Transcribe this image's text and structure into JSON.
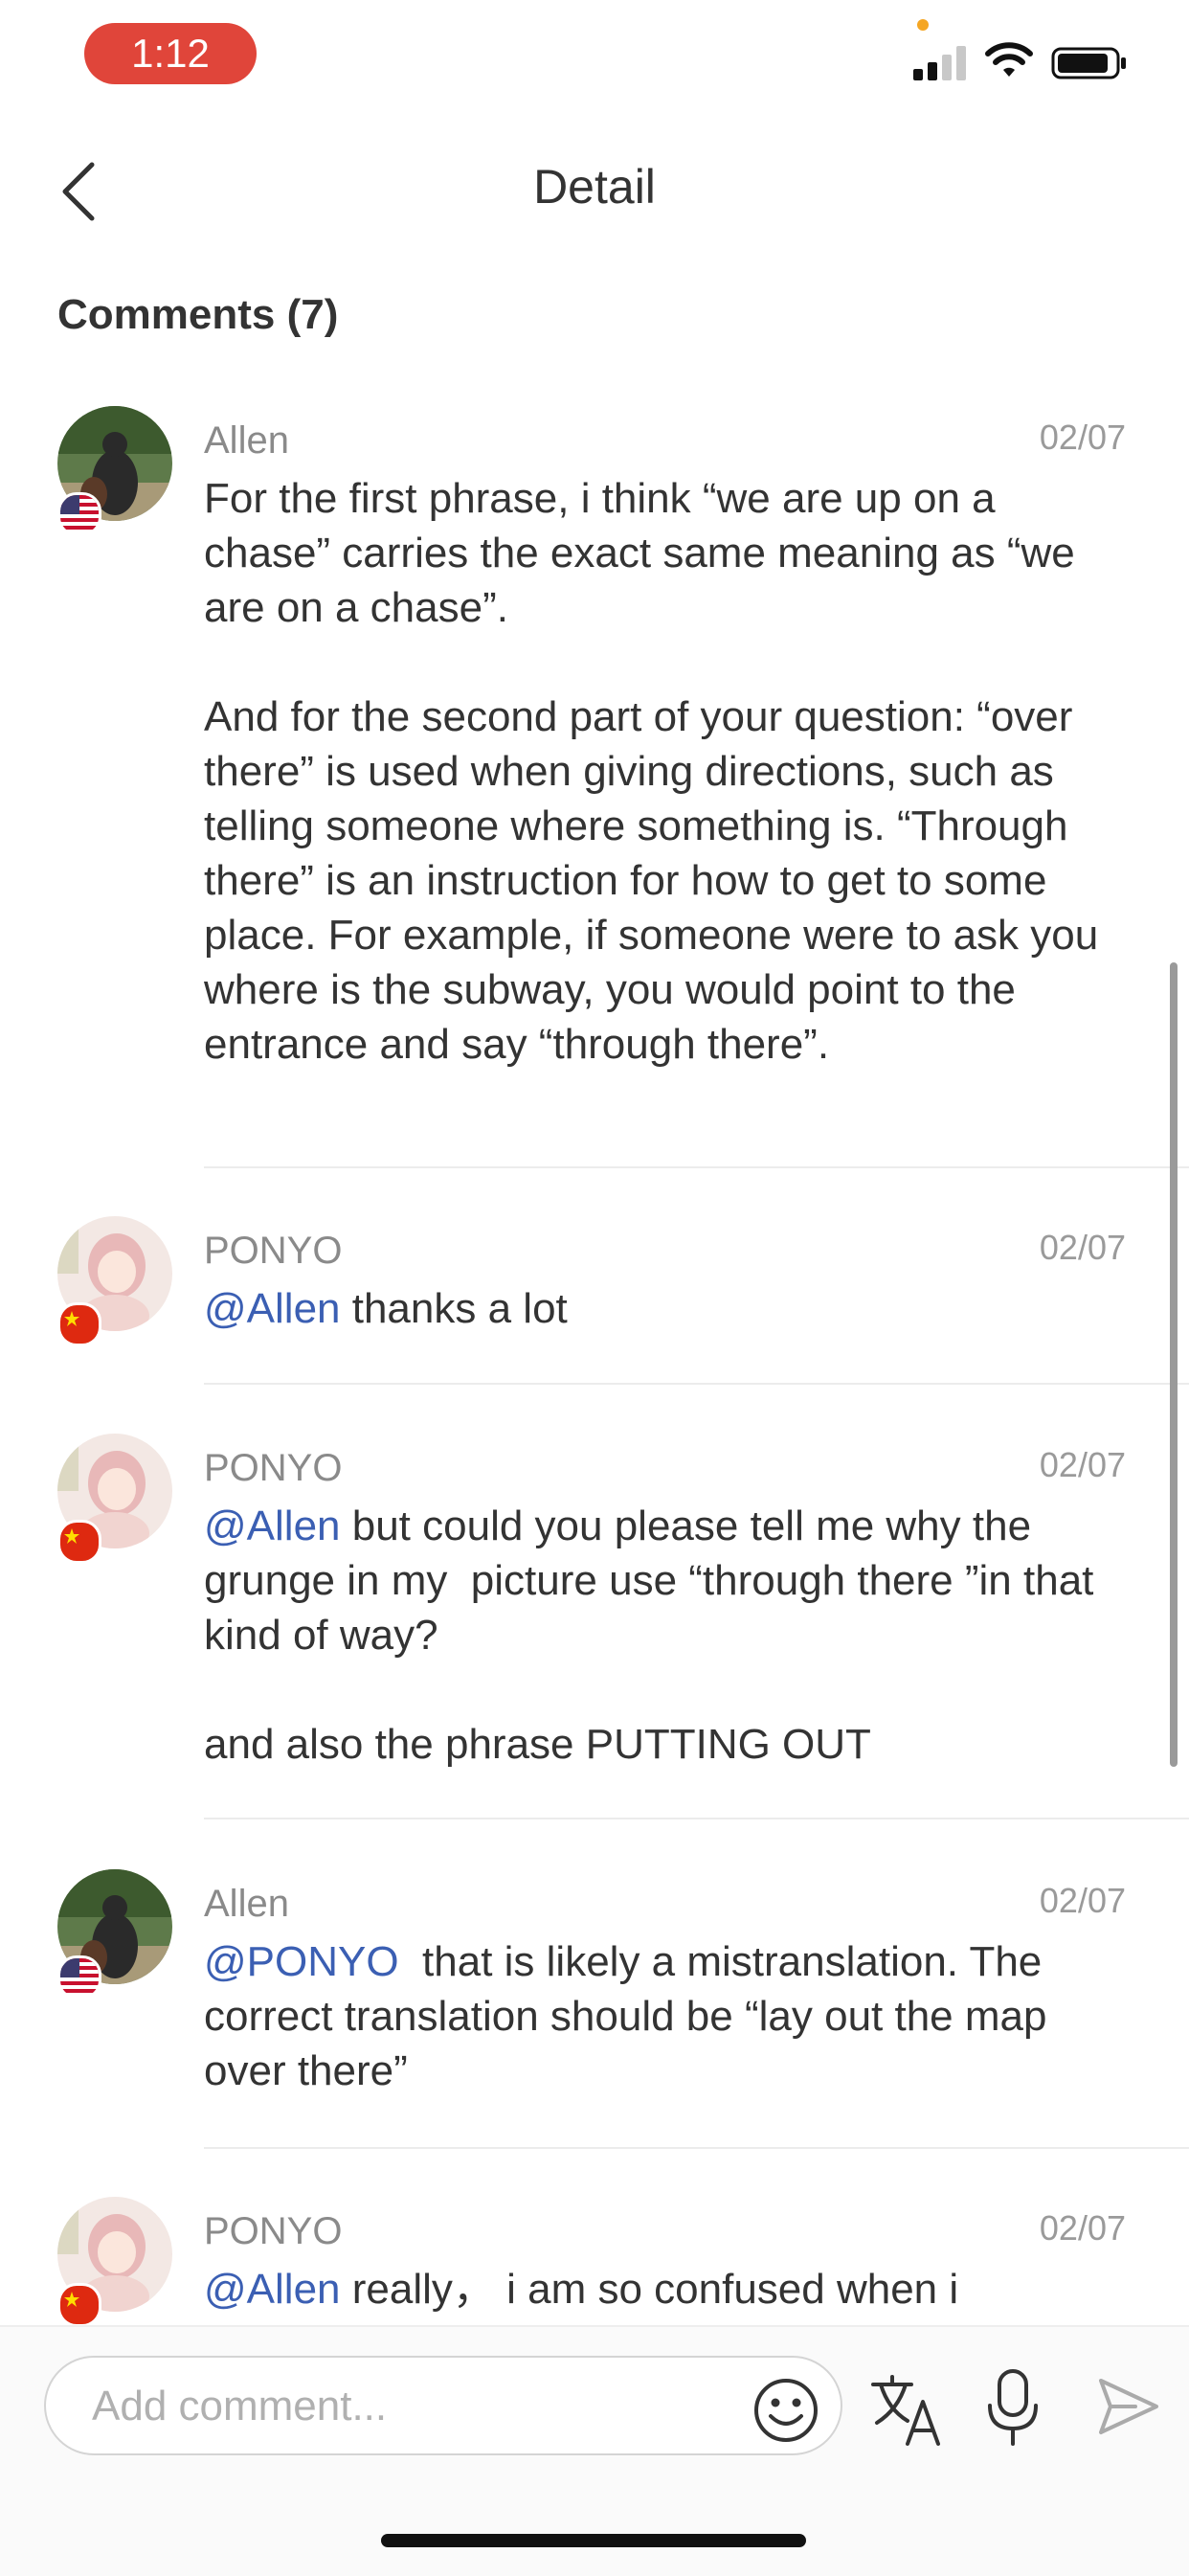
{
  "status_bar": {
    "time": "1:12"
  },
  "header": {
    "title": "Detail"
  },
  "comments_section": {
    "title": "Comments (7)"
  },
  "comments": [
    {
      "author": "Allen",
      "date": "02/07",
      "flag": "us",
      "text": "For the first phrase, i think “we are up on a chase” carries the exact same meaning as “we are on a chase”.\n\nAnd for the second part of your question: “over there” is used when giving directions, such as telling someone where something is. “Through there” is an instruction for how to get to some place. For example, if someone were to ask you where is the subway, you would point to the entrance and say “through there”."
    },
    {
      "author": "PONYO",
      "date": "02/07",
      "flag": "cn",
      "mention": "@Allen",
      "text": " thanks a lot"
    },
    {
      "author": "PONYO",
      "date": "02/07",
      "flag": "cn",
      "mention": "@Allen",
      "text": " but could you please tell me why the grunge in my  picture use “through there ”in that kind of way?\n\nand also the phrase PUTTING OUT"
    },
    {
      "author": "Allen",
      "date": "02/07",
      "flag": "us",
      "mention": "@PONYO",
      "text": "  that is likely a mistranslation. The correct translation should be “lay out the map over there”"
    },
    {
      "author": "PONYO",
      "date": "02/07",
      "flag": "cn",
      "mention": "@Allen",
      "text": " really， i am so confused when i"
    }
  ],
  "composer": {
    "placeholder": "Add comment..."
  },
  "icons": {
    "back": "chevron-left-icon",
    "emoji": "smiley-icon",
    "translate": "translate-icon",
    "mic": "microphone-icon",
    "send": "send-icon"
  },
  "colors": {
    "accent_red": "#e0453a",
    "mention_blue": "#3b5fb3"
  }
}
